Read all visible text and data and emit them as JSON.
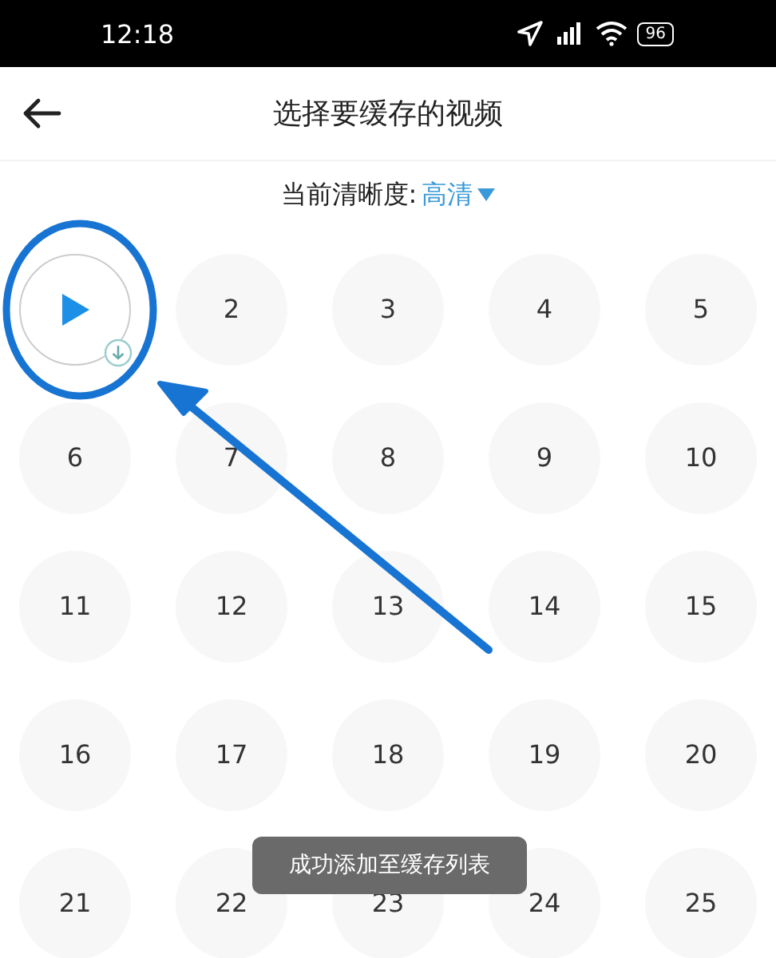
{
  "status_bar": {
    "time": "12:18",
    "battery": "96"
  },
  "header": {
    "title": "选择要缓存的视频"
  },
  "quality": {
    "label": "当前清晰度:",
    "value": "高清"
  },
  "episodes": [
    {
      "kind": "current",
      "added": true
    },
    {
      "kind": "episode",
      "label": "2"
    },
    {
      "kind": "episode",
      "label": "3"
    },
    {
      "kind": "episode",
      "label": "4"
    },
    {
      "kind": "episode",
      "label": "5"
    },
    {
      "kind": "episode",
      "label": "6"
    },
    {
      "kind": "episode",
      "label": "7"
    },
    {
      "kind": "episode",
      "label": "8"
    },
    {
      "kind": "episode",
      "label": "9"
    },
    {
      "kind": "episode",
      "label": "10"
    },
    {
      "kind": "episode",
      "label": "11"
    },
    {
      "kind": "episode",
      "label": "12"
    },
    {
      "kind": "episode",
      "label": "13"
    },
    {
      "kind": "episode",
      "label": "14"
    },
    {
      "kind": "episode",
      "label": "15"
    },
    {
      "kind": "episode",
      "label": "16"
    },
    {
      "kind": "episode",
      "label": "17"
    },
    {
      "kind": "episode",
      "label": "18"
    },
    {
      "kind": "episode",
      "label": "19"
    },
    {
      "kind": "episode",
      "label": "20"
    },
    {
      "kind": "episode",
      "label": "21"
    },
    {
      "kind": "episode",
      "label": "22"
    },
    {
      "kind": "episode",
      "label": "23"
    },
    {
      "kind": "episode",
      "label": "24"
    },
    {
      "kind": "episode",
      "label": "25"
    }
  ],
  "toast": "成功添加至缓存列表"
}
